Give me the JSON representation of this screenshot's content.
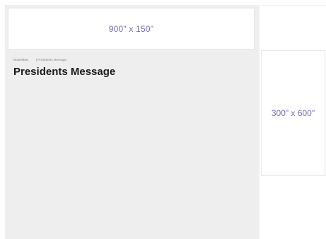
{
  "ads": {
    "banner_label": "900\" x 150\"",
    "sidebar_label": "300\" x 600\""
  },
  "breadcrumb": {
    "date": "November,",
    "current": "| Presidents Message"
  },
  "page": {
    "title": "Presidents Message"
  },
  "colors": {
    "ad_text": "#7b6bb0",
    "content_background": "#eeeeee",
    "title_text": "#1a1a1a"
  }
}
